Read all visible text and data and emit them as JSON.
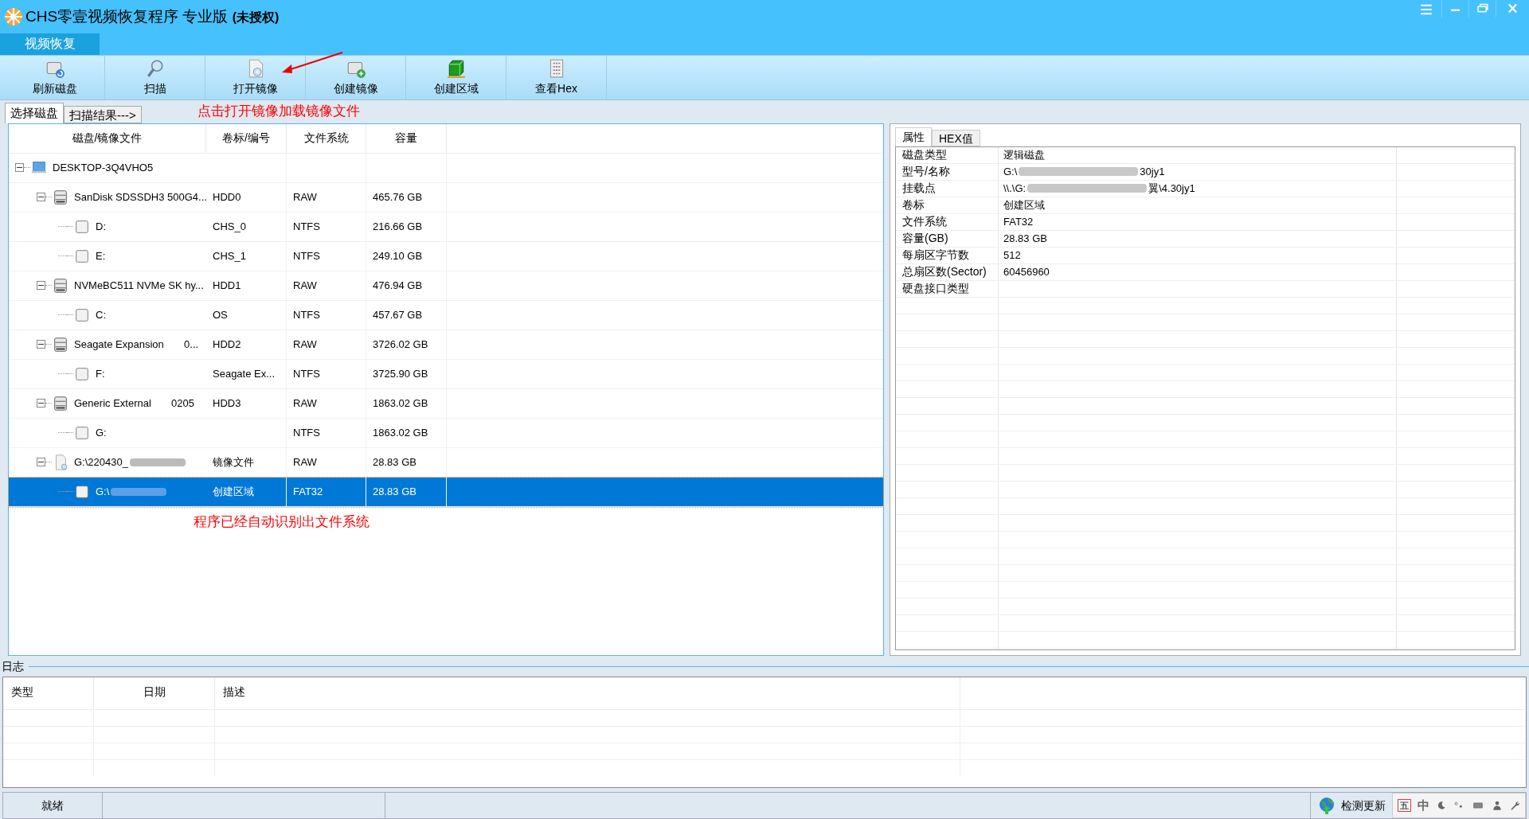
{
  "window": {
    "title": "CHS零壹视频恢复程序 专业版",
    "title_suffix": "(未授权)"
  },
  "menu_tabs": [
    {
      "label": "视频恢复",
      "selected": true
    }
  ],
  "toolbar": [
    {
      "label": "刷新磁盘",
      "kind": "refresh"
    },
    {
      "label": "扫描",
      "kind": "scan"
    },
    {
      "label": "打开镜像",
      "kind": "open"
    },
    {
      "label": "创建镜像",
      "kind": "create"
    },
    {
      "label": "创建区域",
      "kind": "region"
    },
    {
      "label": "查看Hex",
      "kind": "hex"
    }
  ],
  "view_tabs": [
    {
      "label": "选择磁盘",
      "selected": true
    },
    {
      "label": "扫描结果--->",
      "selected": false
    }
  ],
  "annotations": [
    {
      "text": "点击打开镜像加载镜像文件",
      "kind": "arrow"
    },
    {
      "text": "程序已经自动识别出文件系统",
      "kind": "note"
    }
  ],
  "disk_table": {
    "columns": [
      "磁盘/镜像文件",
      "卷标/编号",
      "文件系统",
      "容量"
    ],
    "tree": [
      {
        "kind": "computer",
        "name": "DESKTOP-3Q4VHO5",
        "expanded": true,
        "selected": false,
        "children": [
          {
            "kind": "disk",
            "name": "SanDisk SDSSDH3 500G4...",
            "label": "HDD0",
            "fs": "RAW",
            "size": "465.76 GB",
            "expanded": true,
            "selected": false,
            "children": [
              {
                "kind": "partition",
                "name": "D:",
                "label": "CHS_0",
                "fs": "NTFS",
                "size": "216.66 GB",
                "selected": false
              },
              {
                "kind": "partition",
                "name": "E:",
                "label": "CHS_1",
                "fs": "NTFS",
                "size": "249.10 GB",
                "selected": false
              }
            ]
          },
          {
            "kind": "disk",
            "name": "NVMeBC511 NVMe SK hy...",
            "label": "HDD1",
            "fs": "RAW",
            "size": "476.94 GB",
            "expanded": true,
            "selected": false,
            "children": [
              {
                "kind": "partition",
                "name": "C:",
                "label": "OS",
                "fs": "NTFS",
                "size": "457.67 GB",
                "selected": false
              }
            ]
          },
          {
            "kind": "disk",
            "name": "Seagate Expansion       0...",
            "label": "HDD2",
            "fs": "RAW",
            "size": "3726.02 GB",
            "expanded": true,
            "selected": false,
            "children": [
              {
                "kind": "partition",
                "name": "F:",
                "label": "Seagate Ex...",
                "fs": "NTFS",
                "size": "3725.90 GB",
                "selected": false
              }
            ]
          },
          {
            "kind": "disk",
            "name": "Generic External       0205",
            "label": "HDD3",
            "fs": "RAW",
            "size": "1863.02 GB",
            "expanded": true,
            "selected": false,
            "children": [
              {
                "kind": "partition",
                "name": "G:",
                "fs": "NTFS",
                "size": "1863.02 GB",
                "selected": false
              }
            ]
          },
          {
            "kind": "image",
            "name": "G:\\220430_",
            "label": "镜像文件",
            "fs": "RAW",
            "size": "28.83 GB",
            "expanded": true,
            "selected": false,
            "children": [
              {
                "kind": "partition",
                "name": "G:\\",
                "label": "创建区域",
                "fs": "FAT32",
                "size": "28.83 GB",
                "selected": true
              }
            ]
          }
        ]
      }
    ]
  },
  "properties": {
    "tabs": [
      {
        "label": "属性",
        "selected": true
      },
      {
        "label": "HEX值",
        "selected": false
      }
    ],
    "rows": [
      {
        "name": "磁盘类型",
        "value": "逻辑磁盘"
      },
      {
        "name": "型号/名称",
        "value": "G:\\",
        "value_end": "30jy1"
      },
      {
        "name": "挂载点",
        "value": "\\\\.\\G:",
        "value_end": "翼\\4.30jy1"
      },
      {
        "name": "卷标",
        "value": "创建区域"
      },
      {
        "name": "文件系统",
        "value": "FAT32"
      },
      {
        "name": "容量(GB)",
        "value": "28.83 GB"
      },
      {
        "name": "每扇区字节数",
        "value": "512"
      },
      {
        "name": "总扇区数(Sector)",
        "value": "60456960"
      },
      {
        "name": "硬盘接口类型"
      }
    ]
  },
  "log": {
    "title": "日志",
    "columns": [
      "类型",
      "日期",
      "描述"
    ]
  },
  "status_bar": {
    "status": "就绪",
    "update": "检测更新",
    "ime": [
      "五",
      "中"
    ]
  }
}
